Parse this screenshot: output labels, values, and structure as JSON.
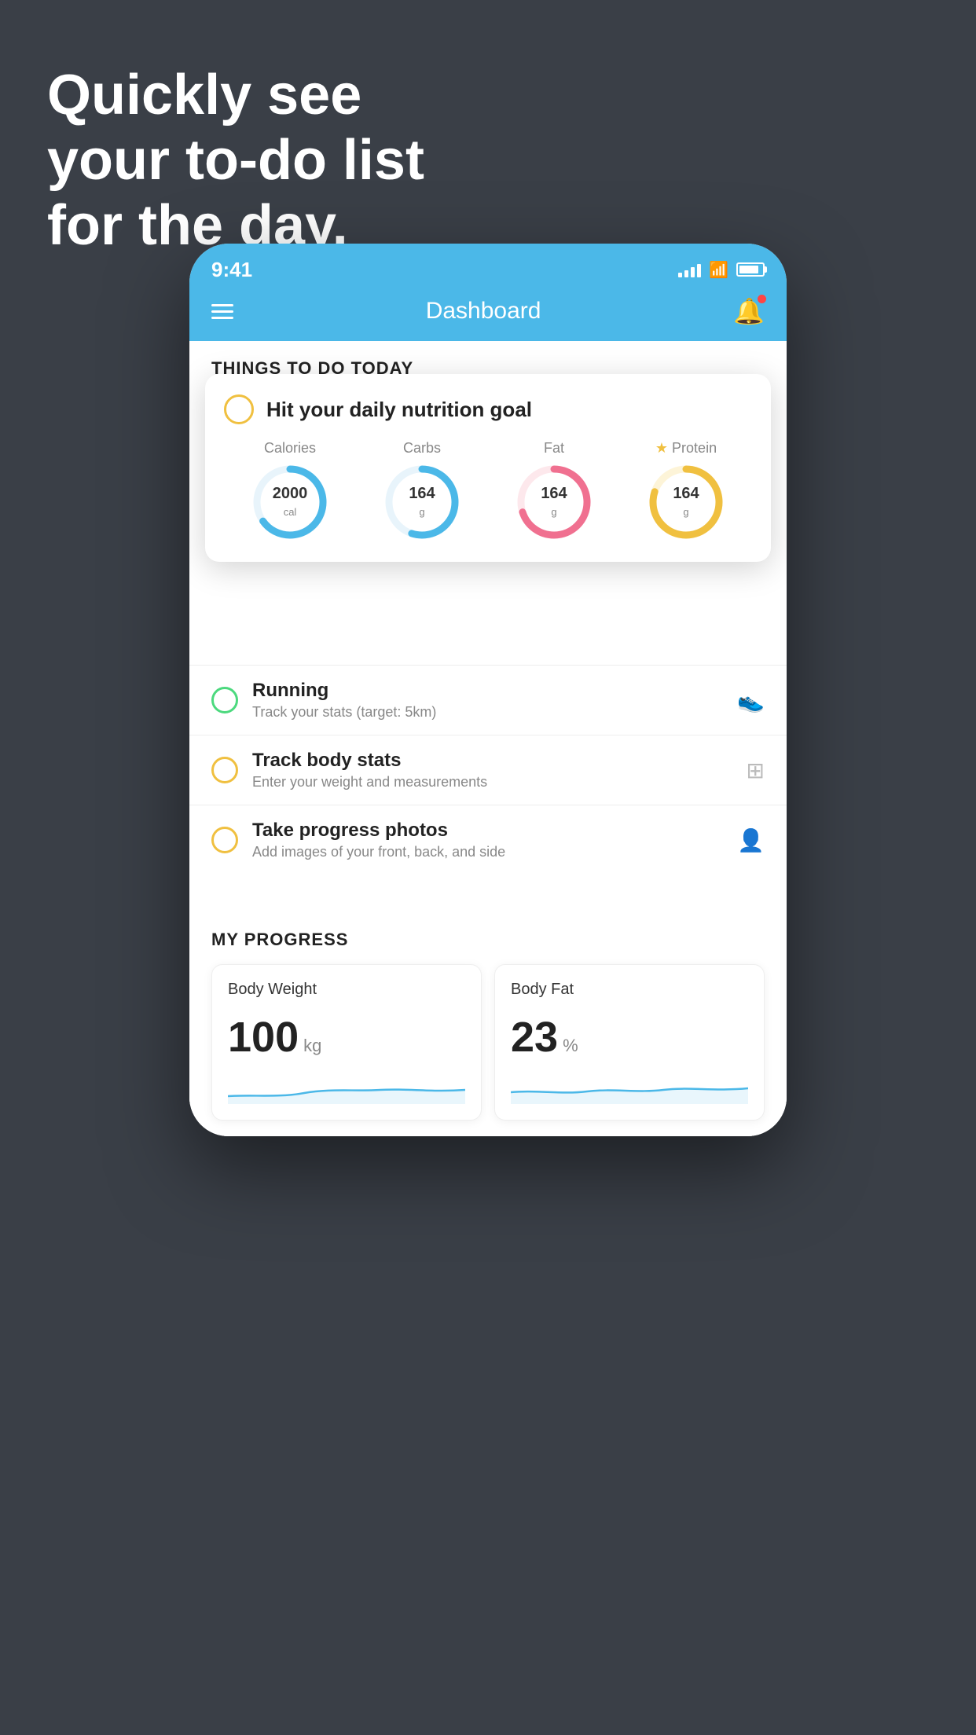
{
  "hero": {
    "line1": "Quickly see",
    "line2": "your to-do list",
    "line3": "for the day."
  },
  "status_bar": {
    "time": "9:41"
  },
  "nav": {
    "title": "Dashboard"
  },
  "things_section": {
    "title": "THINGS TO DO TODAY"
  },
  "nutrition_card": {
    "check_label": "",
    "title": "Hit your daily nutrition goal",
    "rings": [
      {
        "label": "Calories",
        "value": "2000",
        "unit": "cal",
        "color": "#4bb8e8",
        "percent": 65
      },
      {
        "label": "Carbs",
        "value": "164",
        "unit": "g",
        "color": "#4bb8e8",
        "percent": 55
      },
      {
        "label": "Fat",
        "value": "164",
        "unit": "g",
        "color": "#f07090",
        "percent": 70
      },
      {
        "label": "Protein",
        "value": "164",
        "unit": "g",
        "color": "#f0c040",
        "percent": 80,
        "star": true
      }
    ]
  },
  "todo_items": [
    {
      "name": "Running",
      "sub": "Track your stats (target: 5km)",
      "circle_color": "green",
      "icon": "👟"
    },
    {
      "name": "Track body stats",
      "sub": "Enter your weight and measurements",
      "circle_color": "yellow",
      "icon": "⚖"
    },
    {
      "name": "Take progress photos",
      "sub": "Add images of your front, back, and side",
      "circle_color": "yellow",
      "icon": "👤"
    }
  ],
  "progress_section": {
    "title": "MY PROGRESS",
    "cards": [
      {
        "title": "Body Weight",
        "value": "100",
        "unit": "kg"
      },
      {
        "title": "Body Fat",
        "value": "23",
        "unit": "%"
      }
    ]
  }
}
